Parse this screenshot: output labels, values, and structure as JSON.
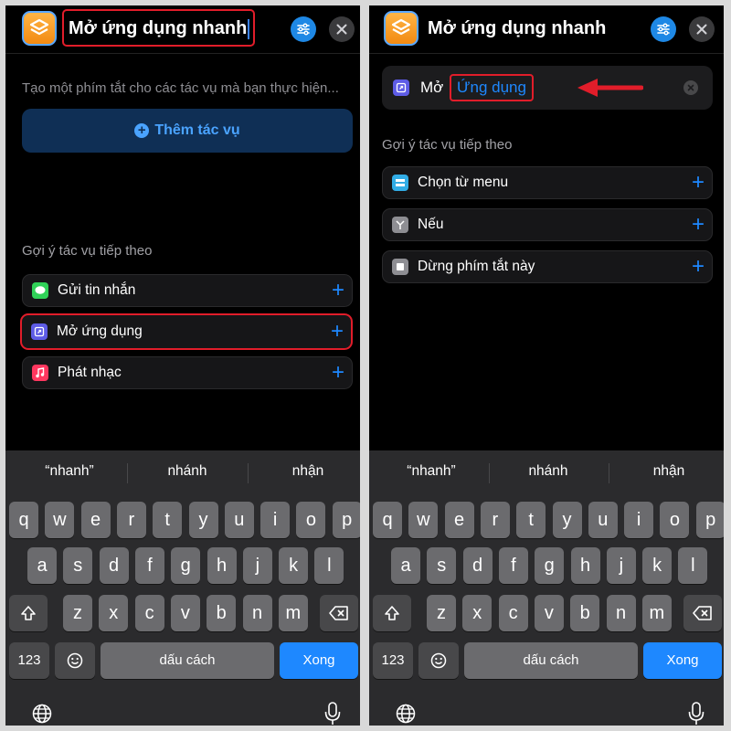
{
  "left": {
    "app_icon": "shortcuts-icon",
    "title": "Mở ứng dụng nhanh",
    "hint": "Tạo một phím tắt cho các tác vụ mà bạn thực hiện...",
    "add_action": "Thêm tác vụ",
    "section_label": "Gợi ý tác vụ tiếp theo",
    "suggestions": [
      {
        "label": "Gửi tin nhắn",
        "icon": "messages-icon",
        "color": "#30d158"
      },
      {
        "label": "Mở ứng dụng",
        "icon": "open-app-icon",
        "color": "#5e5ce6"
      },
      {
        "label": "Phát nhạc",
        "icon": "music-icon",
        "color": "#ff375f"
      }
    ]
  },
  "right": {
    "app_icon": "shortcuts-icon",
    "title": "Mở ứng dụng nhanh",
    "action_verb": "Mở",
    "action_param": "Ứng dụng",
    "section_label": "Gợi ý tác vụ tiếp theo",
    "suggestions": [
      {
        "label": "Chọn từ menu",
        "icon": "menu-icon",
        "color": "#32ade6"
      },
      {
        "label": "Nếu",
        "icon": "if-icon",
        "color": "#8e8e93"
      },
      {
        "label": "Dừng phím tắt này",
        "icon": "stop-icon",
        "color": "#8e8e93"
      }
    ]
  },
  "keyboard": {
    "predictions": [
      "“nhanh”",
      "nhánh",
      "nhận"
    ],
    "row1": [
      "q",
      "w",
      "e",
      "r",
      "t",
      "y",
      "u",
      "i",
      "o",
      "p"
    ],
    "row2": [
      "a",
      "s",
      "d",
      "f",
      "g",
      "h",
      "j",
      "k",
      "l"
    ],
    "row3": [
      "z",
      "x",
      "c",
      "v",
      "b",
      "n",
      "m"
    ],
    "numbers_key": "123",
    "space_key": "dấu cách",
    "done_key": "Xong"
  },
  "colors": {
    "highlight": "#e11d2a",
    "accent": "#1e88ff",
    "arrow": "#e11d2a"
  }
}
